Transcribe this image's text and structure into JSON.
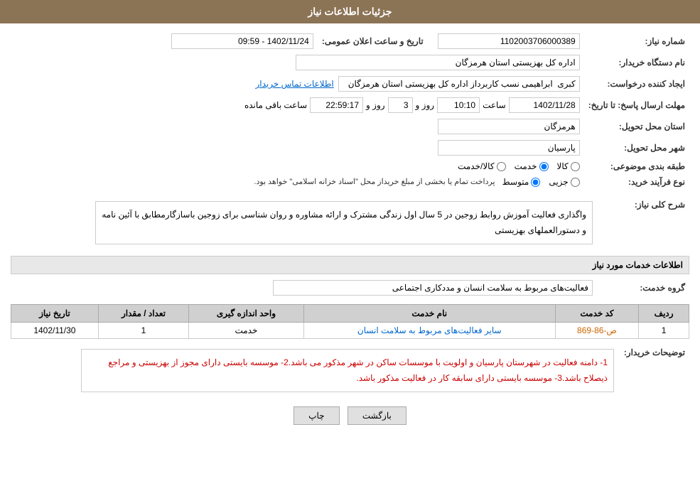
{
  "header": {
    "title": "جزئیات اطلاعات نیاز"
  },
  "fields": {
    "need_number_label": "شماره نیاز:",
    "need_number_value": "1102003706000389",
    "buyer_org_label": "نام دستگاه خریدار:",
    "buyer_org_value": "اداره کل بهزیستی استان هرمزگان",
    "requester_label": "ایجاد کننده درخواست:",
    "requester_value": "کبری  ابراهیمی نسب کاربرداز اداره کل بهزیستی استان هرمزگان",
    "requester_link": "اطلاعات تماس خریدار",
    "deadline_label": "مهلت ارسال پاسخ: تا تاریخ:",
    "deadline_date": "1402/11/28",
    "deadline_time_label": "ساعت",
    "deadline_time": "10:10",
    "deadline_days_label": "روز و",
    "deadline_days": "3",
    "deadline_remaining": "22:59:17",
    "deadline_remaining_label": "ساعت باقی مانده",
    "delivery_province_label": "استان محل تحویل:",
    "delivery_province_value": "هرمزگان",
    "delivery_city_label": "شهر محل تحویل:",
    "delivery_city_value": "پارسیان",
    "category_label": "طبقه بندی موضوعی:",
    "category_options": [
      "کالا",
      "خدمت",
      "کالا/خدمت"
    ],
    "category_selected": "خدمت",
    "purchase_type_label": "نوع فرآیند خرید:",
    "purchase_type_options": [
      "جزیی",
      "متوسط"
    ],
    "purchase_type_selected": "متوسط",
    "purchase_type_note": "پرداخت تمام یا بخشی از مبلغ خریداز محل \"اسناد خزانه اسلامی\" خواهد بود.",
    "announcement_label": "تاریخ و ساعت اعلان عمومی:",
    "announcement_value": "1402/11/24 - 09:59",
    "description_section_label": "شرح کلی نیاز:",
    "description_text": "واگذاری فعالیت آموزش  روابط زوجین در 5 سال اول زندگی مشترک و ارائه مشاوره و روان شناسی برای زوجین باسازگارمطابق با آئین نامه و دستورالعملهای بهزیستی",
    "services_section_label": "اطلاعات خدمات مورد نیاز",
    "service_group_label": "گروه خدمت:",
    "service_group_value": "فعالیت‌های مربوط به سلامت انسان و مددکاری اجتماعی",
    "table": {
      "col_row": "ردیف",
      "col_code": "کد خدمت",
      "col_name": "نام خدمت",
      "col_unit": "واحد اندازه گیری",
      "col_qty": "تعداد / مقدار",
      "col_date": "تاریخ نیاز",
      "rows": [
        {
          "row": "1",
          "code": "ص-86-869",
          "name": "سایر فعالیت‌های مربوط به سلامت انسان",
          "unit": "خدمت",
          "qty": "1",
          "date": "1402/11/30"
        }
      ]
    },
    "notes_label": "توضیحات خریدار:",
    "notes_text": "1- دامنه فعالیت در شهرستان پارسیان و اولویت با موسسات ساکن در شهر مذکور می باشد.2- موسسه بایستی دارای مجوز از بهزیستی و مراجع ذیصلاح باشد.3- موسسه بایستی دارای سابقه کار در فعالیت مذکور باشد."
  },
  "buttons": {
    "print_label": "چاپ",
    "back_label": "بازگشت"
  }
}
